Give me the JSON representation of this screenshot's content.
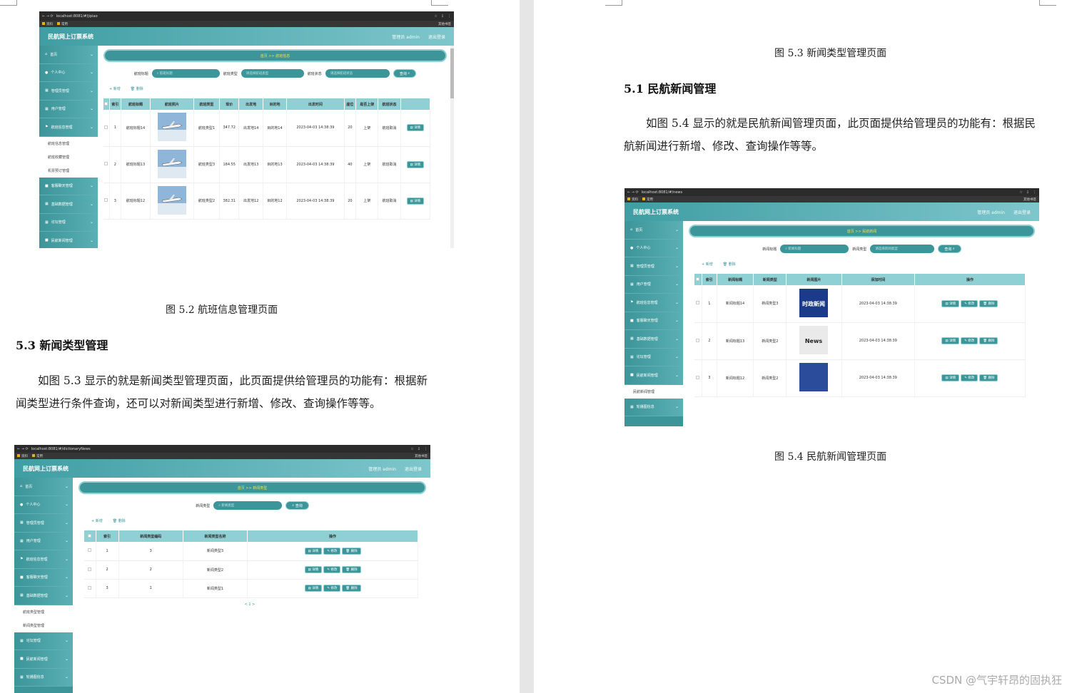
{
  "left_page": {
    "fig2": {
      "url": "localhost:8081/#/jipiao",
      "app_title": "民航网上订票系统",
      "header_right": [
        "管理员 admin",
        "退出登录"
      ],
      "bookmarks": [
        "资料",
        "常用"
      ],
      "bookmarks_right": "其他书签",
      "menu": [
        "首页",
        "个人中心",
        "管理员管理",
        "用户管理",
        "航班信息管理"
      ],
      "submenu": [
        "航班信息管理",
        "航班收藏管理",
        "机票预订管理"
      ],
      "menu_after": [
        "客服聊天管理",
        "基础数据管理",
        "论坛管理",
        "民航新闻管理"
      ],
      "breadcrumb": "首页 >> 航班信息",
      "filters": [
        {
          "label": "航班标题",
          "placeholder": "航班标题"
        },
        {
          "label": "航班类型",
          "placeholder": "请选择航班类型"
        },
        {
          "label": "航班状态",
          "placeholder": "请选择航班状态"
        }
      ],
      "search_btn": "查询",
      "add_btn": "+ 新增",
      "del_btn": "删除",
      "columns": [
        "",
        "索引",
        "航班标题",
        "航班照片",
        "航班类型",
        "现价",
        "出发地",
        "目的地",
        "出发时间",
        "座位",
        "是否上架",
        "航班状态",
        ""
      ],
      "rows": [
        {
          "idx": "1",
          "title": "航班标题14",
          "type": "航班类型1",
          "price": "347.72",
          "from": "出发地14",
          "to": "目的地14",
          "time": "2023-04-03 14:38:39",
          "seats": "20",
          "shelf": "上架",
          "status": "航班取消"
        },
        {
          "idx": "2",
          "title": "航班标题13",
          "type": "航班类型3",
          "price": "184.55",
          "from": "出发地13",
          "to": "目的地13",
          "time": "2023-04-03 14:38:39",
          "seats": "40",
          "shelf": "上架",
          "status": "航班取消"
        },
        {
          "idx": "3",
          "title": "航班标题12",
          "type": "航班类型2",
          "price": "382.31",
          "from": "出发地12",
          "to": "目的地12",
          "time": "2023-04-03 14:38:39",
          "seats": "20",
          "shelf": "上架",
          "status": "航班取消"
        }
      ],
      "detail_btn": "详情"
    },
    "caption_52": "图 5.2  航班信息管理页面",
    "heading_53": "5.3 新闻类型管理",
    "para_53": "如图 5.3 显示的就是新闻类型管理页面，此页面提供给管理员的功能有：根据新闻类型进行条件查询，还可以对新闻类型进行新增、修改、查询操作等等。",
    "fig3": {
      "url": "localhost:8081/#/dictionaryNews",
      "app_title": "民航网上订票系统",
      "header_right": [
        "管理员 admin",
        "退出登录"
      ],
      "menu": [
        "首页",
        "个人中心",
        "管理员管理",
        "用户管理",
        "航班信息管理",
        "客服聊天管理",
        "基础数据管理"
      ],
      "submenu": [
        "航班类型管理",
        "新闻类型管理"
      ],
      "menu_after": [
        "论坛管理",
        "民航新闻管理",
        "轮播图信息"
      ],
      "breadcrumb": "首页 >> 新闻类型",
      "filter_label": "新闻类型",
      "filter_placeholder": "新闻类型",
      "search_btn": "查询",
      "add_btn": "+ 新增",
      "del_btn": "删除",
      "columns": [
        "",
        "索引",
        "新闻类型编码",
        "新闻类型名称",
        "操作"
      ],
      "rows": [
        {
          "idx": "1",
          "code": "3",
          "name": "新闻类型3"
        },
        {
          "idx": "2",
          "code": "2",
          "name": "新闻类型2"
        },
        {
          "idx": "3",
          "code": "1",
          "name": "新闻类型1"
        }
      ],
      "ops": [
        "详情",
        "修改",
        "删除"
      ],
      "pager": "< 1 >"
    }
  },
  "right_page": {
    "caption_53": "图 5.3  新闻类型管理页面",
    "heading_51": "5.1 民航新闻管理",
    "para_54": "如图 5.4 显示的就是民航新闻管理页面，此页面提供给管理员的功能有：根据民航新闻进行新增、修改、查询操作等等。",
    "fig4": {
      "url": "localhost:8081/#/news",
      "app_title": "民航网上订票系统",
      "header_right": [
        "管理员 admin",
        "退出登录"
      ],
      "menu": [
        "首页",
        "个人中心",
        "管理员管理",
        "用户管理",
        "航班信息管理",
        "客服聊天管理",
        "基础数据管理",
        "论坛管理",
        "民航新闻管理"
      ],
      "submenu": [
        "民航新闻管理"
      ],
      "menu_after": [
        "轮播图信息"
      ],
      "breadcrumb": "首页 >> 民航新闻",
      "filters": [
        {
          "label": "新闻标题",
          "placeholder": "新闻标题"
        },
        {
          "label": "新闻类型",
          "placeholder": "请选择新闻类型"
        }
      ],
      "search_btn": "查询",
      "add_btn": "+ 新增",
      "del_btn": "删除",
      "columns": [
        "",
        "索引",
        "新闻标题",
        "新闻类型",
        "新闻图片",
        "添加时间",
        "操作"
      ],
      "rows": [
        {
          "idx": "1",
          "title": "新闻标题14",
          "type": "新闻类型3",
          "img": "时政新闻",
          "time": "2023-04-03 14:38:39"
        },
        {
          "idx": "2",
          "title": "新闻标题13",
          "type": "新闻类型2",
          "img": "News",
          "time": "2023-04-03 14:38:39"
        },
        {
          "idx": "3",
          "title": "新闻标题12",
          "type": "新闻类型2",
          "img": "",
          "time": "2023-04-03 14:38:39"
        }
      ],
      "ops": [
        "详情",
        "修改",
        "删除"
      ]
    },
    "caption_54": "图 5.4  民航新闻管理页面",
    "watermark": "CSDN @气宇轩昂的固执狂"
  }
}
